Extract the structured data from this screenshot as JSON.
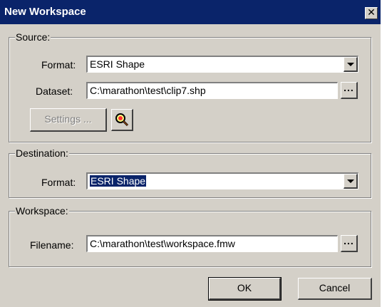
{
  "window": {
    "title": "New Workspace",
    "close_glyph": "✕"
  },
  "source": {
    "legend": "Source:",
    "format_label": "Format:",
    "format_value": "ESRI Shape",
    "dataset_label": "Dataset:",
    "dataset_value": "C:\\marathon\\test\\clip7.shp",
    "browse_label": "...",
    "settings_label": "Settings ...",
    "settings_enabled": false,
    "inspect_icon": "magnifier-icon"
  },
  "destination": {
    "legend": "Destination:",
    "format_label": "Format:",
    "format_value": "ESRI Shape",
    "format_selected": true
  },
  "workspace": {
    "legend": "Workspace:",
    "filename_label": "Filename:",
    "filename_value": "C:\\marathon\\test\\workspace.fmw",
    "browse_label": "..."
  },
  "buttons": {
    "ok": "OK",
    "cancel": "Cancel"
  },
  "colors": {
    "titlebar": "#0a246a",
    "face": "#d4d0c8",
    "selection": "#0a246a"
  }
}
